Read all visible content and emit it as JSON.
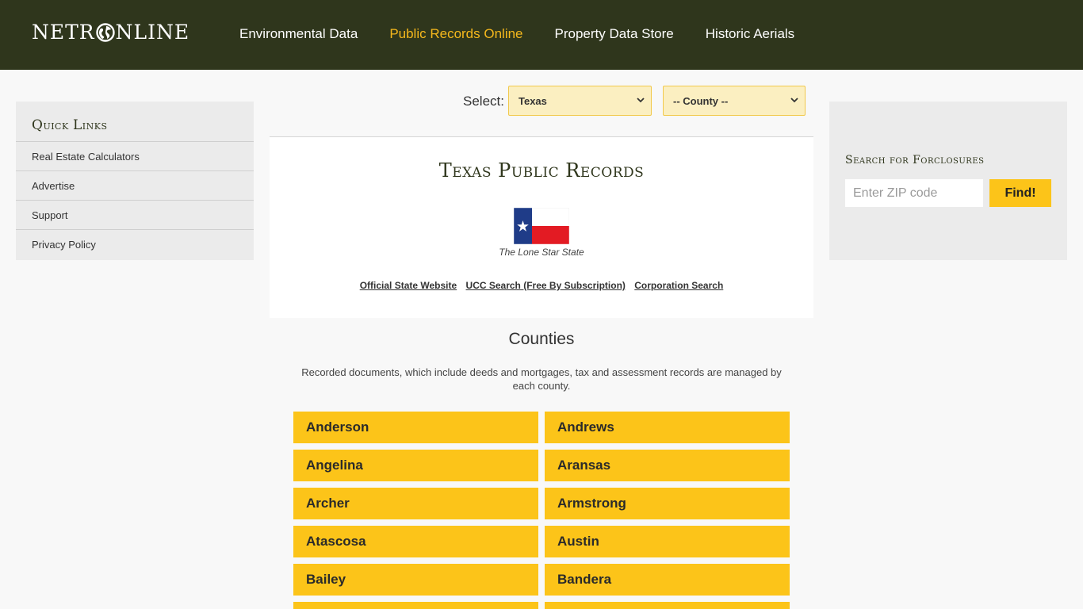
{
  "header": {
    "logo_left": "NETR",
    "logo_right": "NLINE",
    "nav": [
      {
        "label": "Environmental Data",
        "active": false
      },
      {
        "label": "Public Records Online",
        "active": true
      },
      {
        "label": "Property Data Store",
        "active": false
      },
      {
        "label": "Historic Aerials",
        "active": false
      }
    ]
  },
  "quick_links": {
    "title_first": "Q",
    "title_rest": "uick ",
    "title_second": "L",
    "title_rest2": "inks",
    "items": [
      "Real Estate Calculators",
      "Advertise",
      "Support",
      "Privacy Policy"
    ]
  },
  "foreclosure": {
    "title": "Search for Forclosures",
    "placeholder": "Enter ZIP code",
    "button": "Find!"
  },
  "selectors": {
    "label": "Select:",
    "state": "Texas",
    "county": "-- County --"
  },
  "state": {
    "title": "Texas Public Records",
    "nickname": "The Lone Star State",
    "links": [
      "Official State Website",
      "UCC Search (Free By Subscription)",
      "Corporation Search"
    ]
  },
  "counties": {
    "title": "Counties",
    "description": "Recorded documents, which include deeds and mortgages, tax and assessment records are managed by each county.",
    "items": [
      "Anderson",
      "Andrews",
      "Angelina",
      "Aransas",
      "Archer",
      "Armstrong",
      "Atascosa",
      "Austin",
      "Bailey",
      "Bandera",
      "",
      ""
    ]
  },
  "colors": {
    "header_bg": "#2f361c",
    "accent": "#fcc419",
    "nav_active": "#f5b81c"
  }
}
